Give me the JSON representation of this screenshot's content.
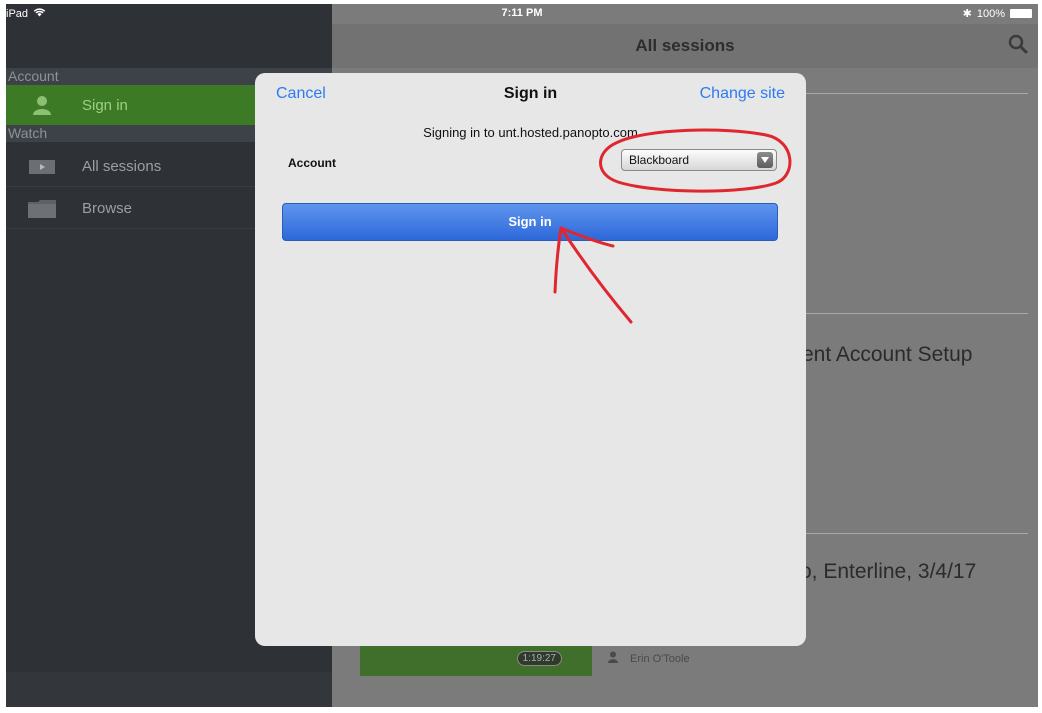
{
  "status_bar": {
    "device": "iPad",
    "time": "7:11 PM",
    "battery": "100%"
  },
  "sidebar": {
    "sections": [
      {
        "header": "Account",
        "items": [
          {
            "label": "Sign in",
            "icon": "person-icon",
            "active": true
          }
        ]
      },
      {
        "header": "Watch",
        "items": [
          {
            "label": "All sessions",
            "icon": "video-icon",
            "active": false
          },
          {
            "label": "Browse",
            "icon": "folder-icon",
            "active": false
          }
        ]
      }
    ]
  },
  "main": {
    "title": "All sessions",
    "background_text": [
      "ent Account Setup",
      "o, Enterline, 3/4/17"
    ],
    "thumbnail_duration": "1:19:27",
    "author": "Erin O'Toole"
  },
  "modal": {
    "cancel_label": "Cancel",
    "title": "Sign in",
    "change_site_label": "Change site",
    "signing_in_text": "Signing in to unt.hosted.panopto.com",
    "account_label": "Account",
    "account_value": "Blackboard",
    "sign_in_button": "Sign in"
  },
  "colors": {
    "accent_blue": "#2b7cf2",
    "sidebar_active": "#3c7a25",
    "annotation_red": "#e0262e",
    "sidebar_bg": "#2e3136"
  }
}
